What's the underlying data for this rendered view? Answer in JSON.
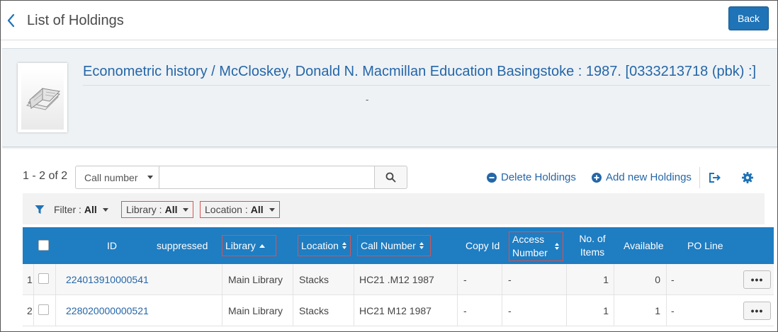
{
  "header": {
    "title": "List of Holdings",
    "back_label": "Back"
  },
  "record": {
    "title": "Econometric history / McCloskey, Donald N. Macmillan Education Basingstoke : 1987. [0333213718 (pbk) :]",
    "subtitle": "-"
  },
  "toolbar": {
    "count": "1 - 2 of 2",
    "search_field": "Call number",
    "search_value": "",
    "search_placeholder": "",
    "delete_label": "Delete Holdings",
    "add_label": "Add new Holdings"
  },
  "filters": {
    "main_label": "Filter :",
    "main_value": "All",
    "library_label": "Library :",
    "library_value": "All",
    "location_label": "Location :",
    "location_value": "All"
  },
  "table": {
    "columns": {
      "id": "ID",
      "suppressed": "suppressed",
      "library": "Library",
      "location": "Location",
      "call_number": "Call Number",
      "copy_id": "Copy Id",
      "access_number_1": "Access",
      "access_number_2": "Number",
      "items_1": "No. of",
      "items_2": "Items",
      "available": "Available",
      "po_line": "PO Line"
    },
    "rows": [
      {
        "index": "1",
        "id": "224013910000541",
        "suppressed": "",
        "library": "Main Library",
        "location": "Stacks",
        "call_number": "HC21 .M12 1987",
        "copy_id": "-",
        "access_number": "-",
        "items": "1",
        "available": "0",
        "po_line": "-",
        "more": "•••"
      },
      {
        "index": "2",
        "id": "228020000000521",
        "suppressed": "",
        "library": "Main Library",
        "location": "Stacks",
        "call_number": "HC21 M12 1987",
        "copy_id": "-",
        "access_number": "-",
        "items": "1",
        "available": "1",
        "po_line": "-",
        "more": "•••"
      }
    ]
  },
  "colors": {
    "accent": "#1f73b7",
    "header_bg": "#1f7dc2",
    "link": "#2566a8",
    "highlight_border": "#d9534f"
  }
}
